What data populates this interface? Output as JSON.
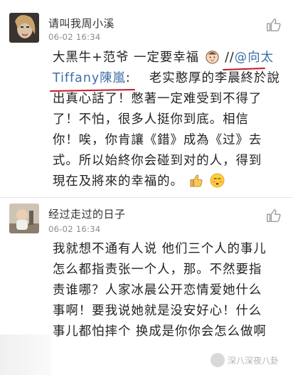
{
  "comments": [
    {
      "username": "请叫我周小溪",
      "time": "06-02 16:34",
      "line1_prefix": "大黑牛+范爷 一定要幸福",
      "line1_sep": " //",
      "mention_a": "@向太",
      "mention_b": "Tiffany陳嵐",
      "mention_b_suffix": ":",
      "line2_rest": "老实憨厚的李晨終於說",
      "lines": [
        "出真心話了！憋著一定难受到不得了",
        "了！不怕，很多人挺你到底。相信",
        "你！唉，你肯讓《錯》成為《过》去",
        "式。所以始終你会碰到对的人，得到",
        "現在及將來的幸福的。"
      ]
    },
    {
      "username": "经过走过的日子",
      "time": "06-02 16:34",
      "lines": [
        "我就想不通有人说 他们三个人的事儿",
        "怎么都指责张一个人，那。不然要指",
        "责谁哪？人家冰晨公开恋情爱她什么",
        "事啊！要我说她就是没安好心！什么",
        "事儿都怕摔个 换成是你你会怎么做啊"
      ]
    }
  ],
  "watermark": "深八深夜八卦",
  "colors": {
    "mention": "#3d6fa8",
    "underline": "#c2182a",
    "time": "#8b8b8b"
  },
  "icons": [
    "thumbs-up-icon",
    "baby-face-emoji",
    "thumbs-up-emoji",
    "blushing-face-emoji"
  ]
}
